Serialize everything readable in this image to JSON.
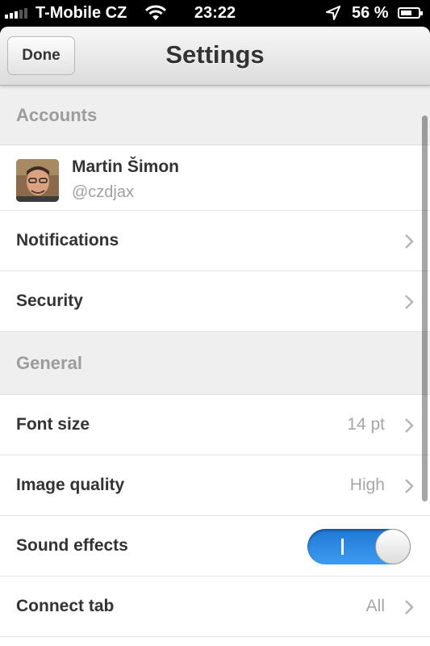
{
  "status_bar": {
    "carrier": "T-Mobile CZ",
    "time": "23:22",
    "battery_percent": "56 %",
    "icons": [
      "signal-icon",
      "wifi-icon",
      "location-icon",
      "battery-icon"
    ]
  },
  "nav": {
    "done_label": "Done",
    "title": "Settings"
  },
  "sections": {
    "accounts": {
      "header": "Accounts",
      "account": {
        "name": "Martin Šimon",
        "handle": "@czdjax"
      },
      "notifications_label": "Notifications",
      "security_label": "Security"
    },
    "general": {
      "header": "General",
      "font_size": {
        "label": "Font size",
        "value": "14 pt"
      },
      "image_quality": {
        "label": "Image quality",
        "value": "High"
      },
      "sound_effects": {
        "label": "Sound effects",
        "enabled": true
      },
      "connect_tab": {
        "label": "Connect tab",
        "value": "All"
      }
    }
  },
  "colors": {
    "toggle_on": "#2a86e2",
    "section_header_bg": "#efefef",
    "label_text": "#333333",
    "value_text": "#a6a6a6"
  }
}
